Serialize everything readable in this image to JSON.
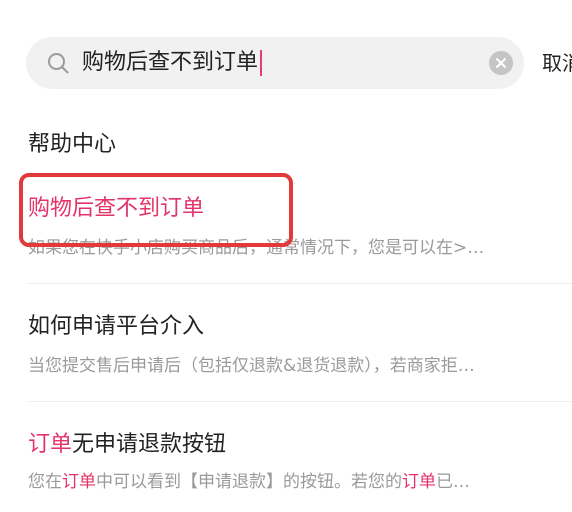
{
  "search": {
    "query": "购物后查不到订单",
    "cancel_label": "取消"
  },
  "section": {
    "title": "帮助中心"
  },
  "results": [
    {
      "title_parts": [
        {
          "text": "购物后查不到订单",
          "hl": true
        }
      ],
      "desc_parts": [
        {
          "text": "如果您在快手小店购买商品后，通常情况下，您是可以在>…",
          "hl": false
        }
      ]
    },
    {
      "title_parts": [
        {
          "text": "如何申请平台介入",
          "hl": false
        }
      ],
      "desc_parts": [
        {
          "text": "当您提交售后申请后（包括仅退款&退货退款），若商家拒…",
          "hl": false
        }
      ]
    },
    {
      "title_parts": [
        {
          "text": "订单",
          "hl": true
        },
        {
          "text": "无申请退款按钮",
          "hl": false
        }
      ],
      "desc_parts": [
        {
          "text": "您在",
          "hl": false
        },
        {
          "text": "订单",
          "hl": true
        },
        {
          "text": "中可以看到【申请退款】的按钮。若您的",
          "hl": false
        },
        {
          "text": "订单",
          "hl": true
        },
        {
          "text": "已…",
          "hl": false
        }
      ]
    }
  ],
  "colors": {
    "highlight": "#e4336a",
    "annotation_box": "#e23a3a"
  }
}
